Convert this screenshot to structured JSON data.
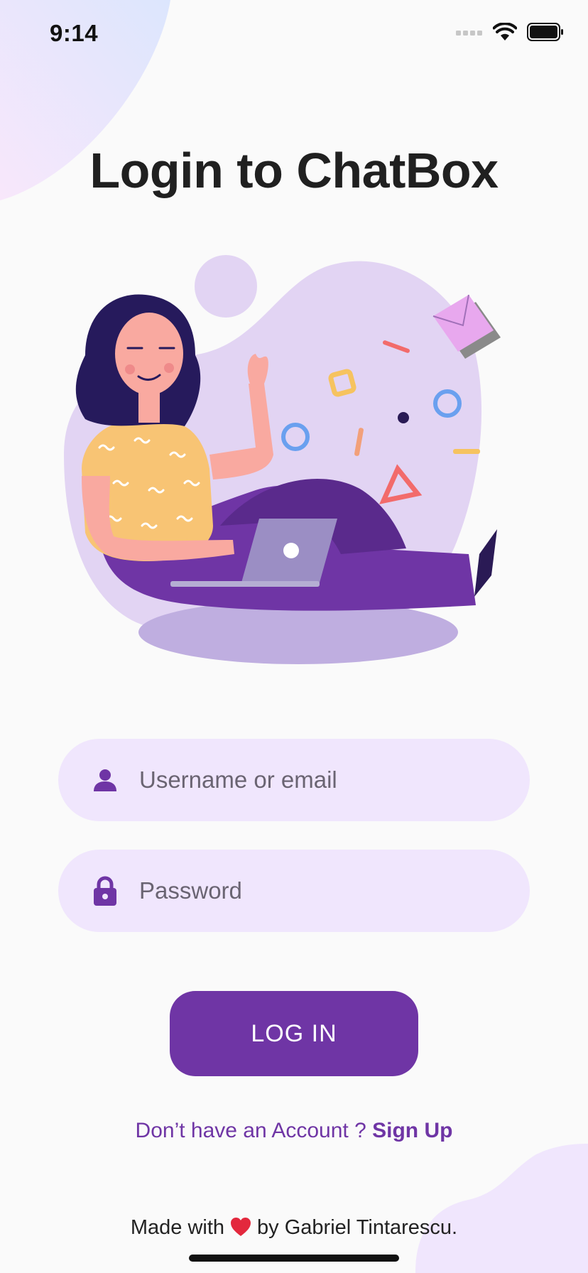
{
  "status_bar": {
    "time": "9:14",
    "icons": [
      "signal-icon",
      "wifi-icon",
      "battery-icon"
    ]
  },
  "page": {
    "title": "Login to ChatBox"
  },
  "form": {
    "username": {
      "placeholder": "Username or email",
      "value": "",
      "icon": "person-icon"
    },
    "password": {
      "placeholder": "Password",
      "value": "",
      "icon": "lock-icon"
    },
    "login_label": "LOG IN"
  },
  "signup": {
    "prompt": "Don’t have an Account ? ",
    "link_label": "Sign Up"
  },
  "footer": {
    "made_with": "Made with",
    "by": "by Gabriel Tintarescu."
  },
  "colors": {
    "primary": "#6f35a5",
    "field_background": "#f0e6fd",
    "background": "#fafafa",
    "illustration_blob": "#e2d4f3"
  }
}
